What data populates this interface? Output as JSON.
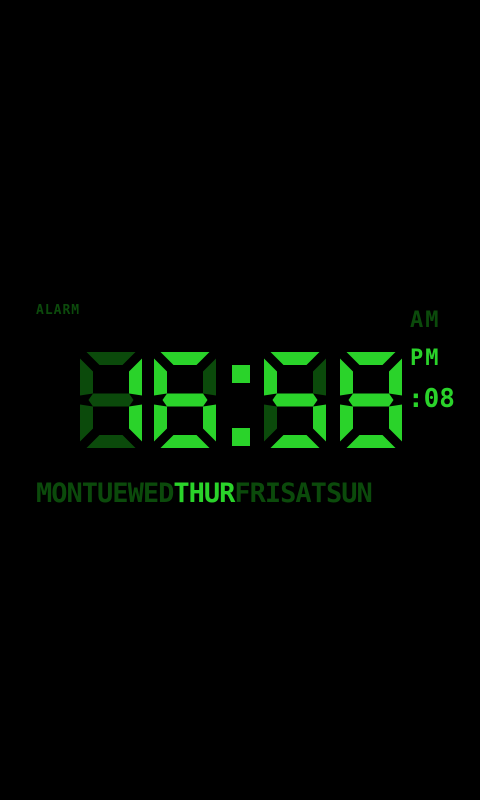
{
  "alarm_label": "ALARM",
  "time": {
    "hours": "16",
    "minutes": "58",
    "seconds": ":08",
    "am_label": "AM",
    "pm_label": "PM",
    "am_pm_active": "PM"
  },
  "days": [
    {
      "label": "MON",
      "active": false
    },
    {
      "label": "TUE",
      "active": false
    },
    {
      "label": "WED",
      "active": false
    },
    {
      "label": "THUR",
      "active": true
    },
    {
      "label": "FRI",
      "active": false
    },
    {
      "label": "SAT",
      "active": false
    },
    {
      "label": "SUN",
      "active": false
    }
  ],
  "colors": {
    "lit": "#2ad32a",
    "unlit": "#0b4a0b",
    "background": "#000000"
  }
}
